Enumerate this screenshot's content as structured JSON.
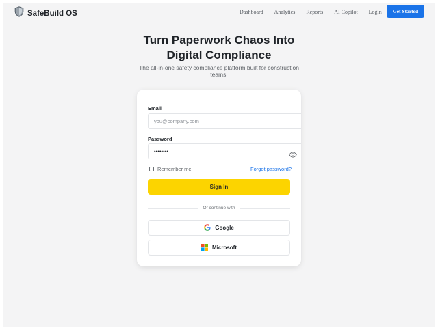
{
  "brand": {
    "name": "SafeBuild OS",
    "logo_icon": "shield-icon"
  },
  "nav": {
    "links": [
      "Dashboard",
      "Analytics",
      "Reports",
      "AI Copilot",
      "Login"
    ],
    "cta_label": "Get Started"
  },
  "hero": {
    "title_line1": "Turn Paperwork Chaos Into",
    "title_line2": "Digital Compliance",
    "subtitle": "The all-in-one safety compliance platform built for construction teams."
  },
  "login": {
    "email_label": "Email",
    "email_placeholder": "you@company.com",
    "password_label": "Password",
    "password_value": "••••••••",
    "password_toggle_icon": "eye-icon",
    "remember_label": "Remember me",
    "remember_checked": false,
    "forgot_label": "Forgot password?",
    "signin_label": "Sign In",
    "divider_text": "Or continue with",
    "google_label": "Google",
    "microsoft_label": "Microsoft"
  },
  "colors": {
    "accent_blue": "#1a73e8",
    "signin_yellow": "#fcd400",
    "page_background": "#f4f4f5",
    "card_background": "#ffffff"
  }
}
